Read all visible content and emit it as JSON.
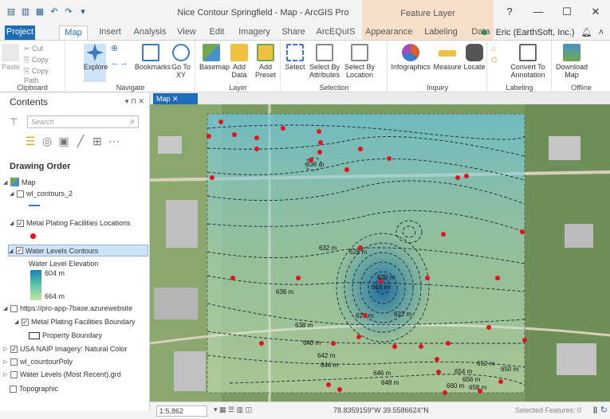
{
  "window": {
    "title": "Nice Contour Springfield - Map - ArcGIS Pro",
    "context_tab": "Feature Layer",
    "controls": [
      "?",
      "—",
      "☐",
      "✕"
    ]
  },
  "tabs": {
    "items": [
      "Project",
      "Map",
      "Insert",
      "Analysis",
      "View",
      "Edit",
      "Imagery",
      "Share",
      "ArcEQuIS",
      "Appearance",
      "Labeling",
      "Data"
    ],
    "active": "Map",
    "user": "Eric (EarthSoft, Inc.)"
  },
  "ribbon": {
    "clipboard": {
      "label": "Clipboard",
      "paste": "Paste",
      "cut": "Cut",
      "copy": "Copy",
      "copy_path": "Copy Path"
    },
    "navigate": {
      "label": "Navigate",
      "explore": "Explore",
      "bookmarks": "Bookmarks",
      "goto": "Go To XY"
    },
    "layer": {
      "label": "Layer",
      "basemap": "Basemap",
      "add_data": "Add Data",
      "add_preset": "Add Preset"
    },
    "selection": {
      "label": "Selection",
      "select": "Select",
      "by_attr": "Select By Attributes",
      "by_loc": "Select By Location"
    },
    "inquiry": {
      "label": "Inquiry",
      "infographics": "Infographics",
      "measure": "Measure",
      "locate": "Locate"
    },
    "labeling": {
      "label": "Labeling",
      "convert": "Convert To Annotation"
    },
    "offline": {
      "label": "Offline",
      "download": "Download Map"
    }
  },
  "contents": {
    "title": "Contents",
    "search_placeholder": "Search",
    "drawing_order": "Drawing Order",
    "layers": [
      {
        "name": "Map",
        "checked": true,
        "level": 0
      },
      {
        "name": "wl_contours_2",
        "checked": false,
        "level": 1
      },
      {
        "name": "Metal Plating Facilities Locations",
        "checked": true,
        "level": 1
      },
      {
        "name": "Water Levels Contours",
        "checked": true,
        "level": 1,
        "selected": true
      },
      {
        "name": "Water Level Elevation",
        "level": 2
      },
      {
        "name": "604 m",
        "level": 3
      },
      {
        "name": "664 m",
        "level": 3
      },
      {
        "name": "https://pro-app-7base.azurewebsite",
        "checked": false,
        "level": 1
      },
      {
        "name": "Metal Plating Facilities Boundary",
        "checked": true,
        "level": 2
      },
      {
        "name": "Property Boundary",
        "level": 3
      },
      {
        "name": "USA NAIP Imagery: Natural Color",
        "checked": true,
        "level": 1
      },
      {
        "name": "wl_countourPoly",
        "checked": false,
        "level": 1
      },
      {
        "name": "Water Levels (Most Recent).grd",
        "checked": false,
        "level": 1
      },
      {
        "name": "Topographic",
        "checked": false,
        "level": 1
      }
    ]
  },
  "map": {
    "tab_label": "Map",
    "contour_labels": [
      "636 m",
      "632 m",
      "628 m",
      "620 m",
      "616 m",
      "636 m",
      "624 m",
      "628 m",
      "622 m",
      "638 m",
      "640 m",
      "642 m",
      "644 m",
      "646 m",
      "648 m",
      "650 m",
      "652 m",
      "654 m",
      "656 m",
      "658 m",
      "660 m"
    ],
    "colors": {
      "marker": "#e3141b",
      "contour": "#1b2a33",
      "overlay_top": "#6cc6e6",
      "overlay_bottom": "#d6ecc5"
    }
  },
  "status": {
    "scale": "1:5,862",
    "coords": "78.8359159°W 39.5586624°N",
    "selected": "Selected Features: 0"
  }
}
